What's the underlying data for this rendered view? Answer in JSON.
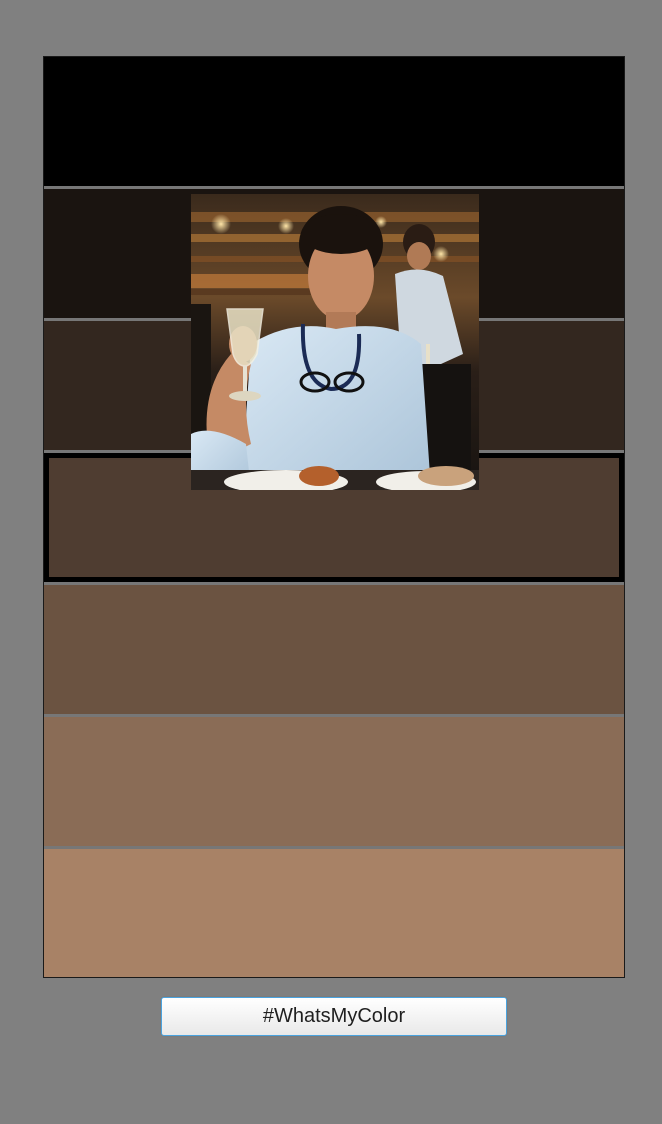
{
  "swatches": [
    {
      "color": "#000000",
      "selected": false
    },
    {
      "color": "#1a1410",
      "selected": false
    },
    {
      "color": "#33271f",
      "selected": false
    },
    {
      "color": "#4f3d31",
      "selected": true
    },
    {
      "color": "#6b5341",
      "selected": false
    },
    {
      "color": "#8a6c56",
      "selected": false
    },
    {
      "color": "#a88266",
      "selected": false
    }
  ],
  "photo": {
    "description_icon": "portrait-photo"
  },
  "action_button": {
    "label": "#WhatsMyColor"
  }
}
